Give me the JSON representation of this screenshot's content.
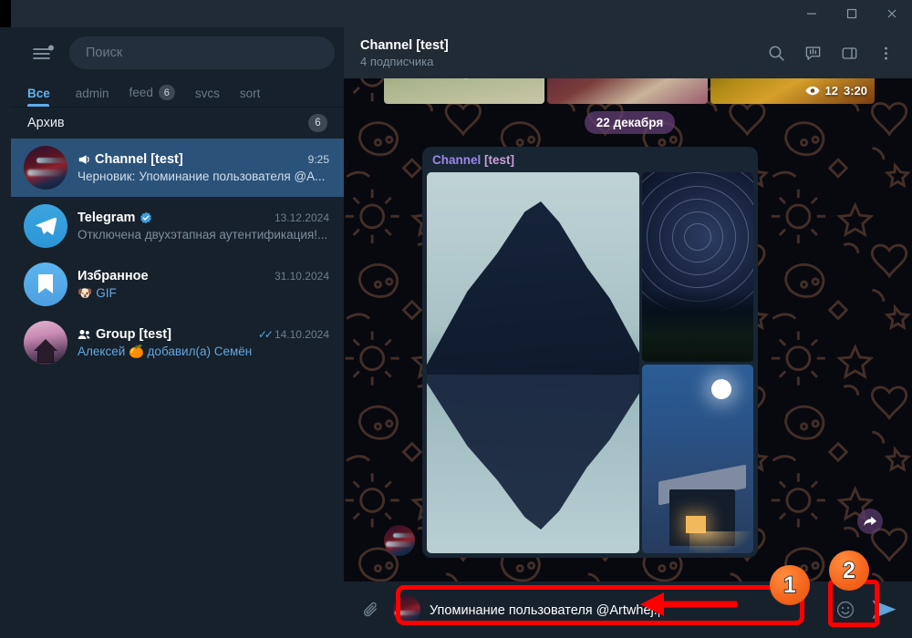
{
  "window": {
    "controls": [
      {
        "name": "minimize",
        "glyph": "—"
      },
      {
        "name": "maximize",
        "glyph": "□"
      },
      {
        "name": "close",
        "glyph": "✕"
      }
    ]
  },
  "sidebar": {
    "menu_icon": "hamburger-menu-icon",
    "search": {
      "placeholder": "Поиск",
      "icon": "search-icon"
    },
    "filters": [
      {
        "label": "Все",
        "count": null,
        "active": true
      },
      {
        "label": "admin",
        "count": null,
        "active": false
      },
      {
        "label": "feed",
        "count": "6",
        "active": false
      },
      {
        "label": "svcs",
        "count": null,
        "active": false
      },
      {
        "label": "sort",
        "count": null,
        "active": false
      }
    ],
    "archive": {
      "label": "Архив",
      "count": "6"
    },
    "chats": [
      {
        "name": "Channel [test]",
        "time": "9:25",
        "preview_prefix": "Черновик:",
        "preview": "Упоминание пользователя @A...",
        "avatar": "channel-landscape-avatar",
        "icon": "megaphone-icon",
        "selected": true,
        "verified": false,
        "ticks": false
      },
      {
        "name": "Telegram",
        "time": "13.12.2024",
        "preview_prefix": "",
        "preview": "Отключена двухэтапная аутентификация!...",
        "avatar": "telegram-logo-avatar",
        "icon": "",
        "selected": false,
        "verified": true,
        "ticks": false
      },
      {
        "name": "Избранное",
        "time": "31.10.2024",
        "preview_prefix": "",
        "preview": "GIF",
        "avatar": "saved-messages-avatar",
        "icon": "",
        "selected": false,
        "verified": false,
        "ticks": false,
        "preview_emoji": "🐶"
      },
      {
        "name": "Group [test]",
        "time": "14.10.2024",
        "preview_prefix": "",
        "preview": "Алексей 🍊 добавил(а) Семён",
        "avatar": "group-house-avatar",
        "icon": "group-people-icon",
        "selected": false,
        "verified": false,
        "ticks": true
      }
    ]
  },
  "chat_header": {
    "title": "Channel [test]",
    "subtitle": "4 подписчика",
    "actions": [
      {
        "name": "search-icon",
        "label": "Поиск"
      },
      {
        "name": "statistics-icon",
        "label": "Статистика"
      },
      {
        "name": "toggle-panel-icon",
        "label": "Панель"
      },
      {
        "name": "more-menu-icon",
        "label": "Ещё"
      }
    ]
  },
  "conversation": {
    "top_album": {
      "views": "12",
      "time": "3:20",
      "views_icon": "eye-icon",
      "forward_icon": "forward-icon"
    },
    "date_divider": "22 декабря",
    "message": {
      "author_name": "Channel",
      "author_tag": "[test]",
      "album_photos": [
        {
          "name": "mountain-lake-reflection-photo"
        },
        {
          "name": "star-trails-night-photo"
        },
        {
          "name": "moonlit-cabin-photo"
        }
      ],
      "forward_icon": "forward-icon"
    }
  },
  "composer": {
    "attach_icon": "paperclip-icon",
    "avatar": "sender-avatar",
    "text": "Упоминание пользователя @Artwhej!",
    "emoji_icon": "smiley-icon",
    "send_icon": "send-icon"
  },
  "annotations": {
    "markers": [
      {
        "number": "1",
        "target": "message-input"
      },
      {
        "number": "2",
        "target": "send-button"
      }
    ],
    "highlight_color": "#ff0000",
    "marker_color": "#f4641a"
  }
}
